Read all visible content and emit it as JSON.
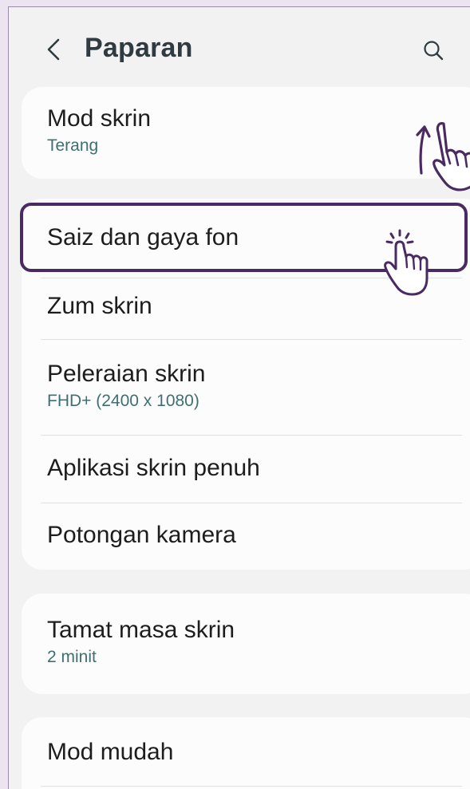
{
  "header": {
    "title": "Paparan",
    "back_icon": "chevron-left-icon",
    "search_icon": "search-icon"
  },
  "items": [
    {
      "title": "Mod skrin",
      "subtitle": "Terang"
    },
    {
      "title": "Saiz dan gaya fon"
    },
    {
      "title": "Zum skrin"
    },
    {
      "title": "Peleraian skrin",
      "subtitle": "FHD+ (2400 x 1080)"
    },
    {
      "title": "Aplikasi skrin penuh"
    },
    {
      "title": "Potongan kamera"
    },
    {
      "title": "Tamat masa skrin",
      "subtitle": "2 minit"
    },
    {
      "title": "Mod mudah"
    }
  ],
  "annotations": {
    "highlight_color": "#4a2a63",
    "gesture_icons": [
      "scroll-up-hand-icon",
      "tap-hand-icon"
    ]
  },
  "colors": {
    "background": "#f2f2f2",
    "card": "#fcfcfc",
    "subtitle": "#3f6f72",
    "title": "#2f3b40"
  }
}
